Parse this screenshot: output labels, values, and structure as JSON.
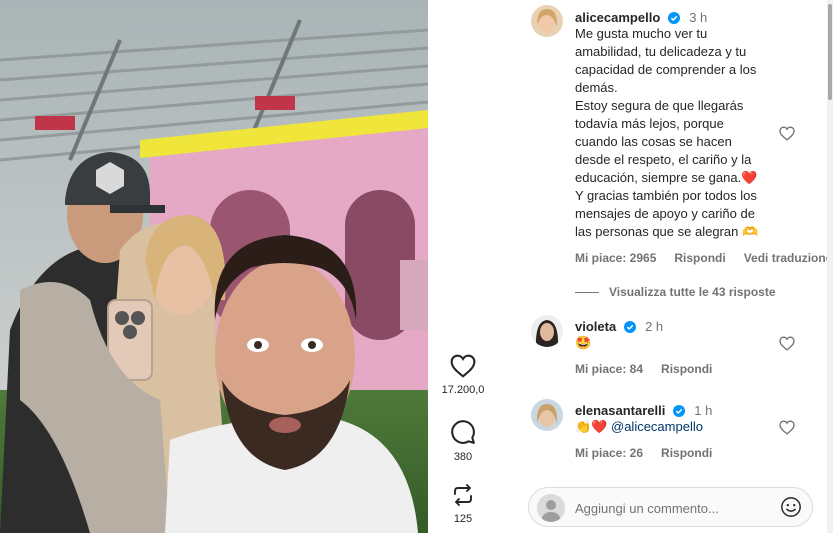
{
  "post": {
    "likes_count": "17.200,0",
    "comments_count": "380",
    "reposts_count": "125"
  },
  "comments": [
    {
      "username": "alicecampello",
      "time": "3 h",
      "lines": [
        "Me gusta mucho ver tu",
        "amabilidad, tu delicadeza y tu",
        "capacidad de comprender a los",
        "demás.",
        "Estoy segura de que llegarás",
        "todavía más lejos, porque",
        "cuando las cosas se hacen",
        "desde el respeto, el cariño y la",
        "educación, siempre se gana.❤️",
        "Y gracias también por todos los",
        "mensajes de apoyo y cariño de",
        "las personas que se alegran 🫶"
      ],
      "likes_label": "Mi piace: 2965",
      "reply_label": "Rispondi",
      "translate_label": "Vedi traduzione",
      "view_replies": "Visualizza tutte le 43 risposte"
    },
    {
      "username": "violeta",
      "time": "2 h",
      "text": "🤩",
      "likes_label": "Mi piace: 84",
      "reply_label": "Rispondi"
    },
    {
      "username": "elenasantarelli",
      "time": "1 h",
      "text_emoji": "👏❤️",
      "mention": "@alicecampello",
      "likes_label": "Mi piace: 26",
      "reply_label": "Rispondi"
    }
  ],
  "composer": {
    "placeholder": "Aggiungi un commento..."
  },
  "icons": {
    "like": "heart-icon",
    "comment": "speech-bubble-icon",
    "repost": "repost-icon",
    "emoji": "smiley-icon",
    "verified": "verified-badge-icon"
  },
  "colors": {
    "verified_blue": "#0095f6",
    "muted_text": "#737373",
    "mention": "#00376b"
  }
}
